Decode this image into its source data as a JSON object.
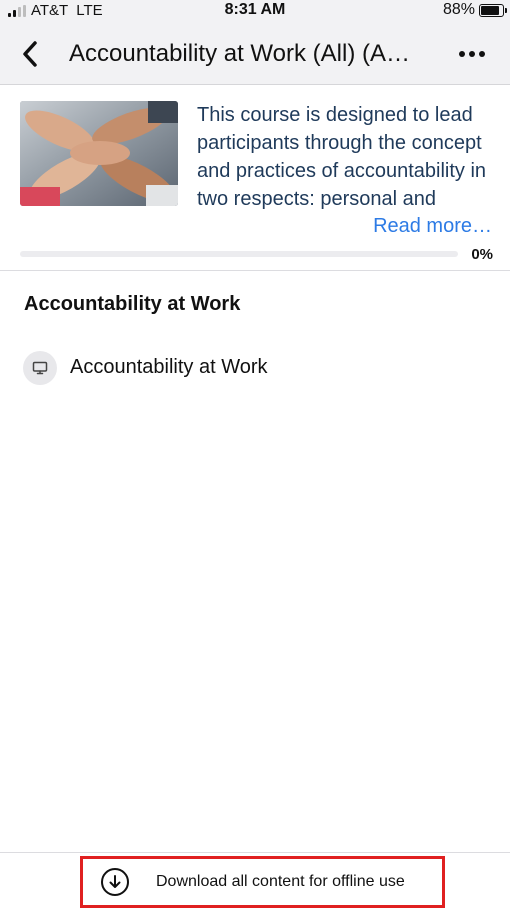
{
  "status_bar": {
    "carrier": "AT&T",
    "network": "LTE",
    "time": "8:31 AM",
    "battery": "88%",
    "battery_level": 0.88,
    "signal_bars_filled": 2,
    "signal_bars_total": 4
  },
  "nav": {
    "title": "Accountability at Work (All) (A…",
    "back_icon": "chevron-left-icon",
    "more_icon": "more-horizontal-icon"
  },
  "course": {
    "description": "This course is designed to lead participants through the concept and practices of accountability in two respects: personal and",
    "read_more": "Read more…",
    "progress_label": "0%",
    "progress_value": 0,
    "accent_color": "#2d7be5"
  },
  "section": {
    "title": "Accountability at Work",
    "items": [
      {
        "label": "Accountability at Work",
        "icon": "monitor-icon"
      }
    ]
  },
  "bottom": {
    "download_label": "Download all content for offline use",
    "download_icon": "download-circle-icon",
    "highlight_color": "#e02020"
  }
}
